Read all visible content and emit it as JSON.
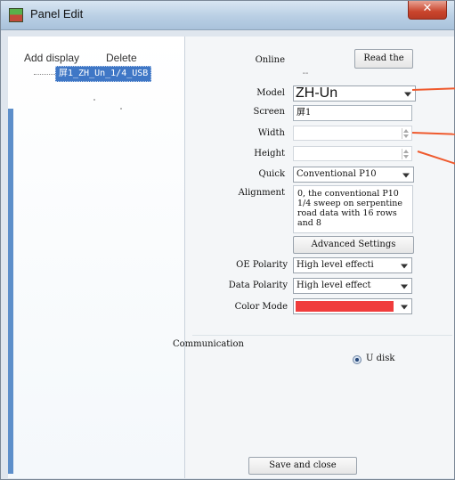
{
  "window": {
    "title": "Panel Edit",
    "close_glyph": "✕"
  },
  "tree": {
    "add_label": "Add display",
    "delete_label": "Delete",
    "item_label": "屏1_ZH_Un_1/4_USB"
  },
  "form": {
    "online_label": "Online",
    "read_button": "Read the",
    "dash": "--",
    "model_label": "Model",
    "model_value": "ZH-Un",
    "screen_label": "Screen",
    "screen_value": "屏1",
    "width_label": "Width",
    "width_value": "",
    "height_label": "Height",
    "height_value": "",
    "quick_label": "Quick",
    "quick_value": "Conventional P10",
    "alignment_label": "Alignment",
    "alignment_text": "0, the conventional P10 1/4 sweep on serpentine road data with 16 rows and 8",
    "advanced_button": "Advanced Settings",
    "oe_label": "OE Polarity",
    "oe_value": "High level effecti",
    "data_polarity_label": "Data Polarity",
    "data_polarity_value": "High level effect",
    "color_mode_label": "Color Mode",
    "color_mode_value": "",
    "communication_label": "Communication",
    "udisk_label": "U disk",
    "save_button": "Save and close"
  },
  "colors": {
    "color_mode_swatch": "#f03c3c",
    "annotation": "#ef5a2e",
    "selection": "#3f77c6"
  }
}
